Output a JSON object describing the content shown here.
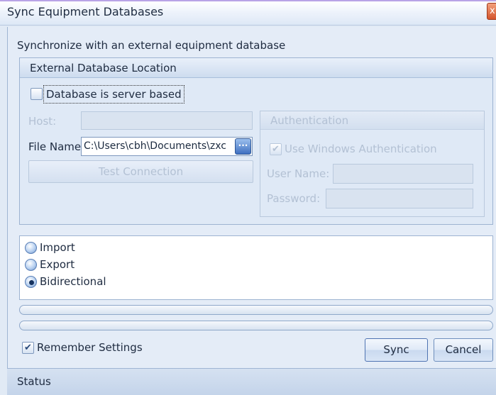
{
  "window": {
    "title": "Sync Equipment Databases",
    "close_glyph": "x"
  },
  "subtitle": "Synchronize with an external equipment database",
  "db_location": {
    "title": "External Database Location",
    "server_based": {
      "label": "Database is server based",
      "checked": false
    },
    "host": {
      "label": "Host:",
      "value": ""
    },
    "file_name": {
      "label": "File Name",
      "value": "C:\\Users\\cbh\\Documents\\zxc",
      "browse_glyph": "···"
    },
    "test_connection_label": "Test Connection",
    "authentication": {
      "title": "Authentication",
      "use_windows": {
        "label": "Use Windows Authentication",
        "checked": true
      },
      "user_name": {
        "label": "User Name:",
        "value": ""
      },
      "password": {
        "label": "Password:",
        "value": ""
      }
    }
  },
  "direction": {
    "options": [
      {
        "label": "Import",
        "selected": false
      },
      {
        "label": "Export",
        "selected": false
      },
      {
        "label": "Bidirectional",
        "selected": true
      }
    ]
  },
  "progress": [
    {
      "value": 0
    },
    {
      "value": 0
    }
  ],
  "remember": {
    "label": "Remember Settings",
    "checked": true
  },
  "buttons": {
    "sync": "Sync",
    "cancel": "Cancel"
  },
  "status": "Status",
  "glyphs": {
    "check": "✔"
  }
}
